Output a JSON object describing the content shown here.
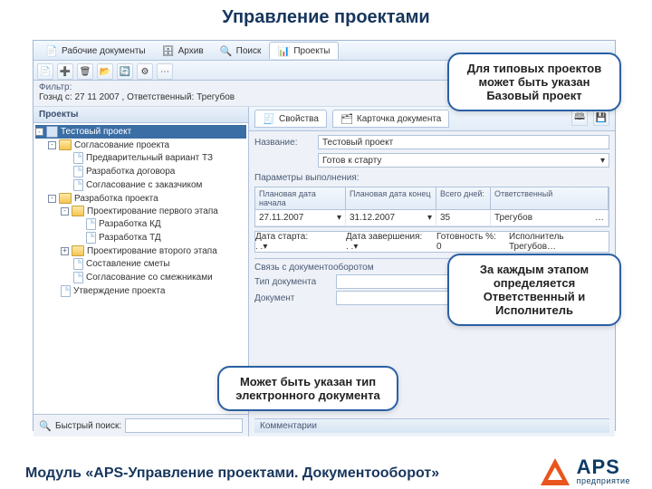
{
  "slide": {
    "title": "Управление проектами",
    "footer": "Модуль «APS-Управление проектами. Документооборот»"
  },
  "logo": {
    "brand": "APS",
    "subtitle": "предприятие"
  },
  "callouts": {
    "c1": "Для типовых проектов может быть указан Базовый проект",
    "c2": "За каждым этапом определяется Ответственный и Исполнитель",
    "c3": "Может быть указан тип электронного документа"
  },
  "tabs": {
    "docs": "Рабочие документы",
    "archive": "Архив",
    "search": "Поиск",
    "projects": "Проекты"
  },
  "filter": {
    "label": "Фильтр:",
    "value": "Гознд с: 27 11 2007 , Ответственный: Трегубов"
  },
  "left_panel": {
    "title": "Проекты",
    "quick_search": "Быстрый поиск:"
  },
  "tree": [
    {
      "level": 0,
      "icon": "root",
      "label": "Тестовый проект",
      "sel": true,
      "exp": "-"
    },
    {
      "level": 1,
      "icon": "folder",
      "label": "Согласование проекта",
      "exp": "-"
    },
    {
      "level": 2,
      "icon": "doc",
      "label": "Предварительный вариант ТЗ"
    },
    {
      "level": 2,
      "icon": "doc",
      "label": "Разработка договора"
    },
    {
      "level": 2,
      "icon": "doc",
      "label": "Согласование с заказчиком"
    },
    {
      "level": 1,
      "icon": "folder",
      "label": "Разработка проекта",
      "exp": "-"
    },
    {
      "level": 2,
      "icon": "folder",
      "label": "Проектирование первого этапа",
      "exp": "-"
    },
    {
      "level": 3,
      "icon": "doc",
      "label": "Разработка КД"
    },
    {
      "level": 3,
      "icon": "doc",
      "label": "Разработка ТД"
    },
    {
      "level": 2,
      "icon": "folder",
      "label": "Проектирование второго этапа",
      "exp": "+"
    },
    {
      "level": 2,
      "icon": "doc",
      "label": "Составление сметы"
    },
    {
      "level": 2,
      "icon": "doc",
      "label": "Согласование со смежниками"
    },
    {
      "level": 1,
      "icon": "doc",
      "label": "Утверждение проекта"
    }
  ],
  "right": {
    "tab_props": "Свойства",
    "tab_card": "Карточка документа",
    "name_label": "Название:",
    "name_value": "Тестовый проект",
    "status_value": "Готов к старту",
    "params_title": "Параметры выполнения:",
    "headers1": [
      "Плановая дата начала",
      "Плановая дата конец",
      "Всего дней:",
      "Ответственный"
    ],
    "row1": [
      "27.11.2007",
      "31.12.2007",
      "35",
      "Трегубов"
    ],
    "headers2": [
      "Дата старта:",
      "Дата завершения:",
      "Готовность %:",
      "Исполнитель"
    ],
    "row2": [
      ". .",
      ". .",
      "0",
      "Трегубов"
    ],
    "doclink_title": "Связь с документооборотом",
    "doctype_label": "Тип документа",
    "doc_label": "Документ",
    "comments_title": "Комментарии"
  }
}
